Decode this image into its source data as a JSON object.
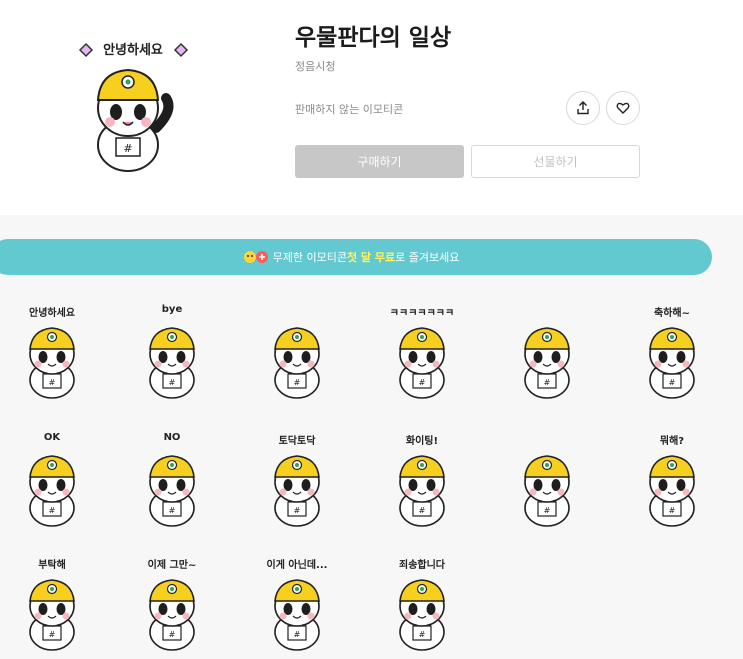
{
  "product": {
    "title": "우물판다의 일상",
    "author": "정음시청",
    "status": "판매하지 않는 이모티콘",
    "buy_label": "구매하기",
    "gift_label": "선물하기",
    "hero_caption": "안녕하세요"
  },
  "banner": {
    "text_before": "무제한 이모티콘 ",
    "highlight": "첫 달 무료",
    "text_after": "로 즐겨보세요"
  },
  "stickers": [
    {
      "caption": "안녕하세요"
    },
    {
      "caption": "bye"
    },
    {
      "caption": ""
    },
    {
      "caption": "ㅋㅋㅋㅋㅋㅋㅋ"
    },
    {
      "caption": ""
    },
    {
      "caption": "축하해~"
    },
    {
      "caption": "OK"
    },
    {
      "caption": "NO"
    },
    {
      "caption": "토닥토닥"
    },
    {
      "caption": "화이팅!"
    },
    {
      "caption": ""
    },
    {
      "caption": "뭐해?"
    },
    {
      "caption": "부탁해"
    },
    {
      "caption": "이제 그만~"
    },
    {
      "caption": "이게 아닌데..."
    },
    {
      "caption": "죄송합니다"
    }
  ],
  "colors": {
    "banner_bg": "#62c9d0",
    "highlight": "#fff45e",
    "helmet": "#f6cf1f",
    "buy_disabled": "#c7c7c7"
  }
}
